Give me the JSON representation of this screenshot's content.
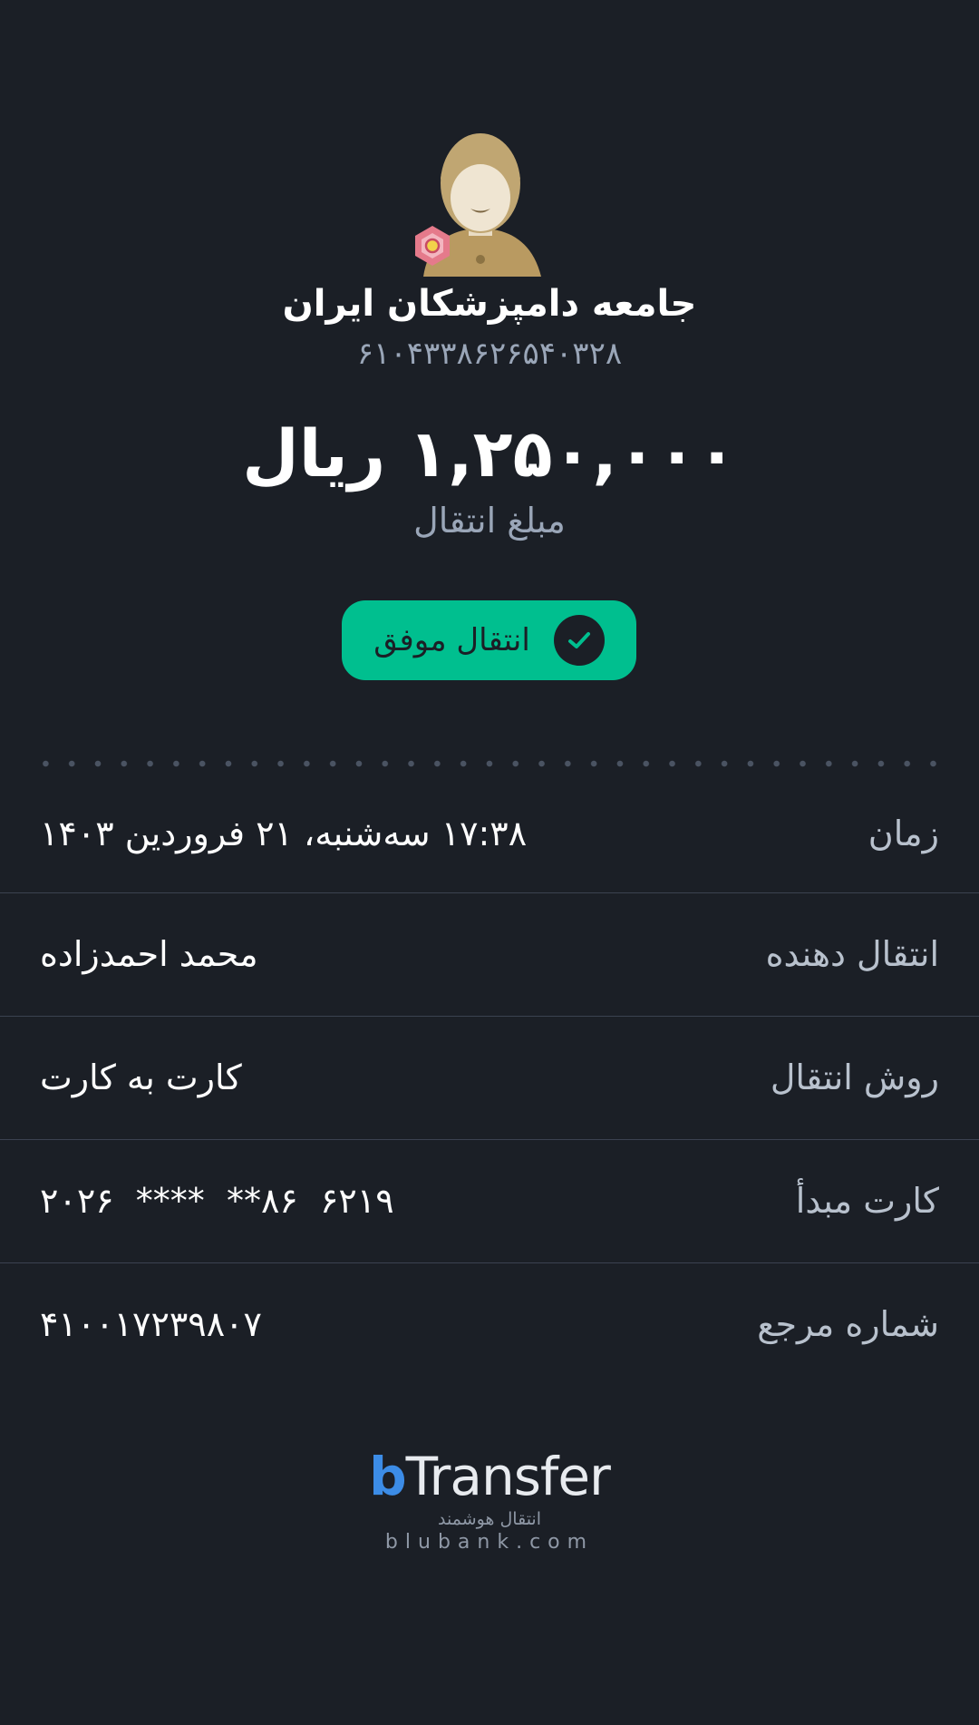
{
  "recipient": {
    "name": "جامعه دامپزشکان ایران",
    "number": "۶۱۰۴۳۳۸۶۲۶۵۴۰۳۲۸"
  },
  "transfer": {
    "amount": "۱,۲۵۰,۰۰۰ ریال",
    "amount_caption": "مبلغ انتقال",
    "status_label": "انتقال موفق"
  },
  "details": [
    {
      "label": "زمان",
      "value": "۱۷:۳۸ سه‌شنبه، ۲۱ فروردین ۱۴۰۳"
    },
    {
      "label": "انتقال دهنده",
      "value": "محمد احمدزاده"
    },
    {
      "label": "روش انتقال",
      "value": "کارت به کارت"
    },
    {
      "label": "کارت مبدأ",
      "value": "۶۲۱۹  ۸۶**  ****  ۲۰۲۶"
    },
    {
      "label": "شماره مرجع",
      "value": "۴۱۰۰۱۷۲۳۹۸۰۷"
    }
  ],
  "brand": {
    "logo_b": "b",
    "logo_text": "Transfer",
    "tagline": "انتقال هوشمند",
    "domain": "blubank.com"
  },
  "colors": {
    "background": "#1b1f26",
    "success": "#00bf8f",
    "brand_blue": "#3c8ce6",
    "muted_text": "#9aa6b8"
  },
  "icons": [
    "avatar-icon",
    "bank-logo-icon",
    "check-icon"
  ]
}
